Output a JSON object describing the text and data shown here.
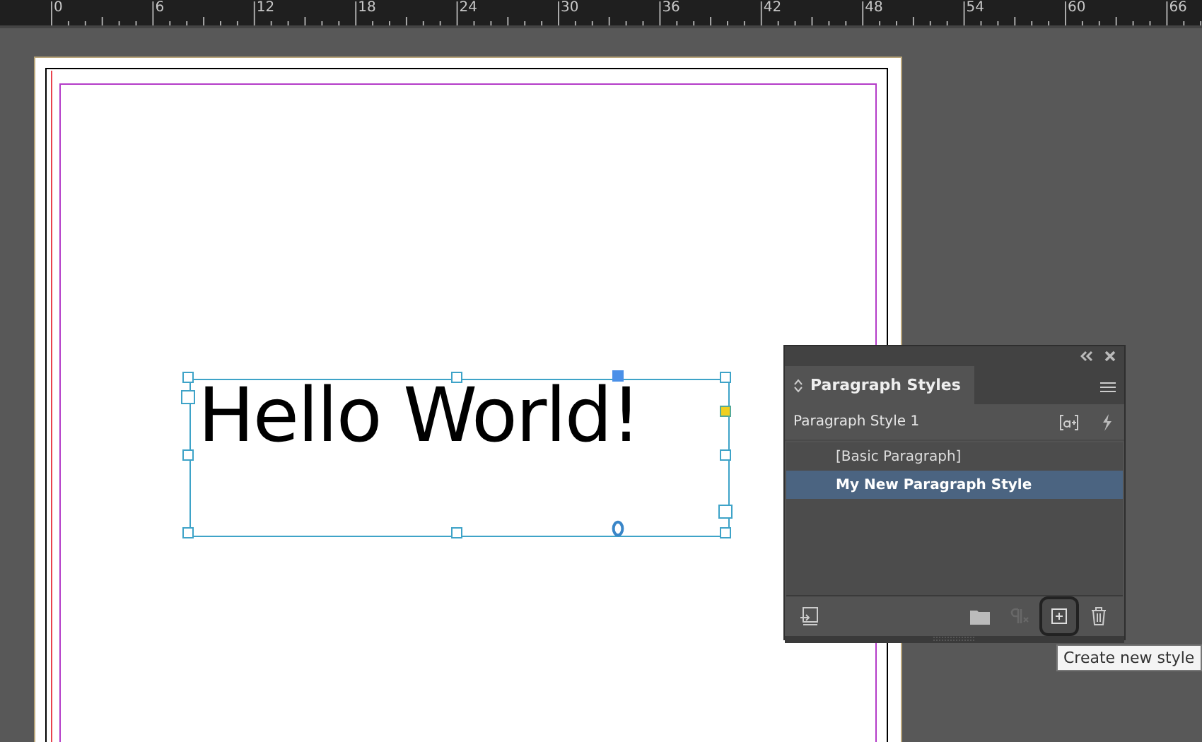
{
  "ruler": {
    "labels": [
      "0",
      "6",
      "12",
      "18",
      "24",
      "30",
      "36",
      "42",
      "48",
      "54",
      "60",
      "66"
    ]
  },
  "document": {
    "text": "Hello World!"
  },
  "panel": {
    "title": "Paragraph Styles",
    "current_style": "Paragraph Style 1",
    "styles": [
      {
        "label": "[Basic Paragraph]",
        "selected": false
      },
      {
        "label": "My New Paragraph Style",
        "selected": true
      }
    ],
    "footer_buttons": [
      {
        "kind": "load",
        "disabled": false,
        "hovered": false
      },
      {
        "kind": "folder",
        "disabled": false,
        "hovered": false
      },
      {
        "kind": "clear-overrides",
        "disabled": true,
        "hovered": false
      },
      {
        "kind": "new",
        "disabled": false,
        "hovered": true
      },
      {
        "kind": "delete",
        "disabled": false,
        "hovered": false
      }
    ],
    "tooltip": "Create new style"
  }
}
